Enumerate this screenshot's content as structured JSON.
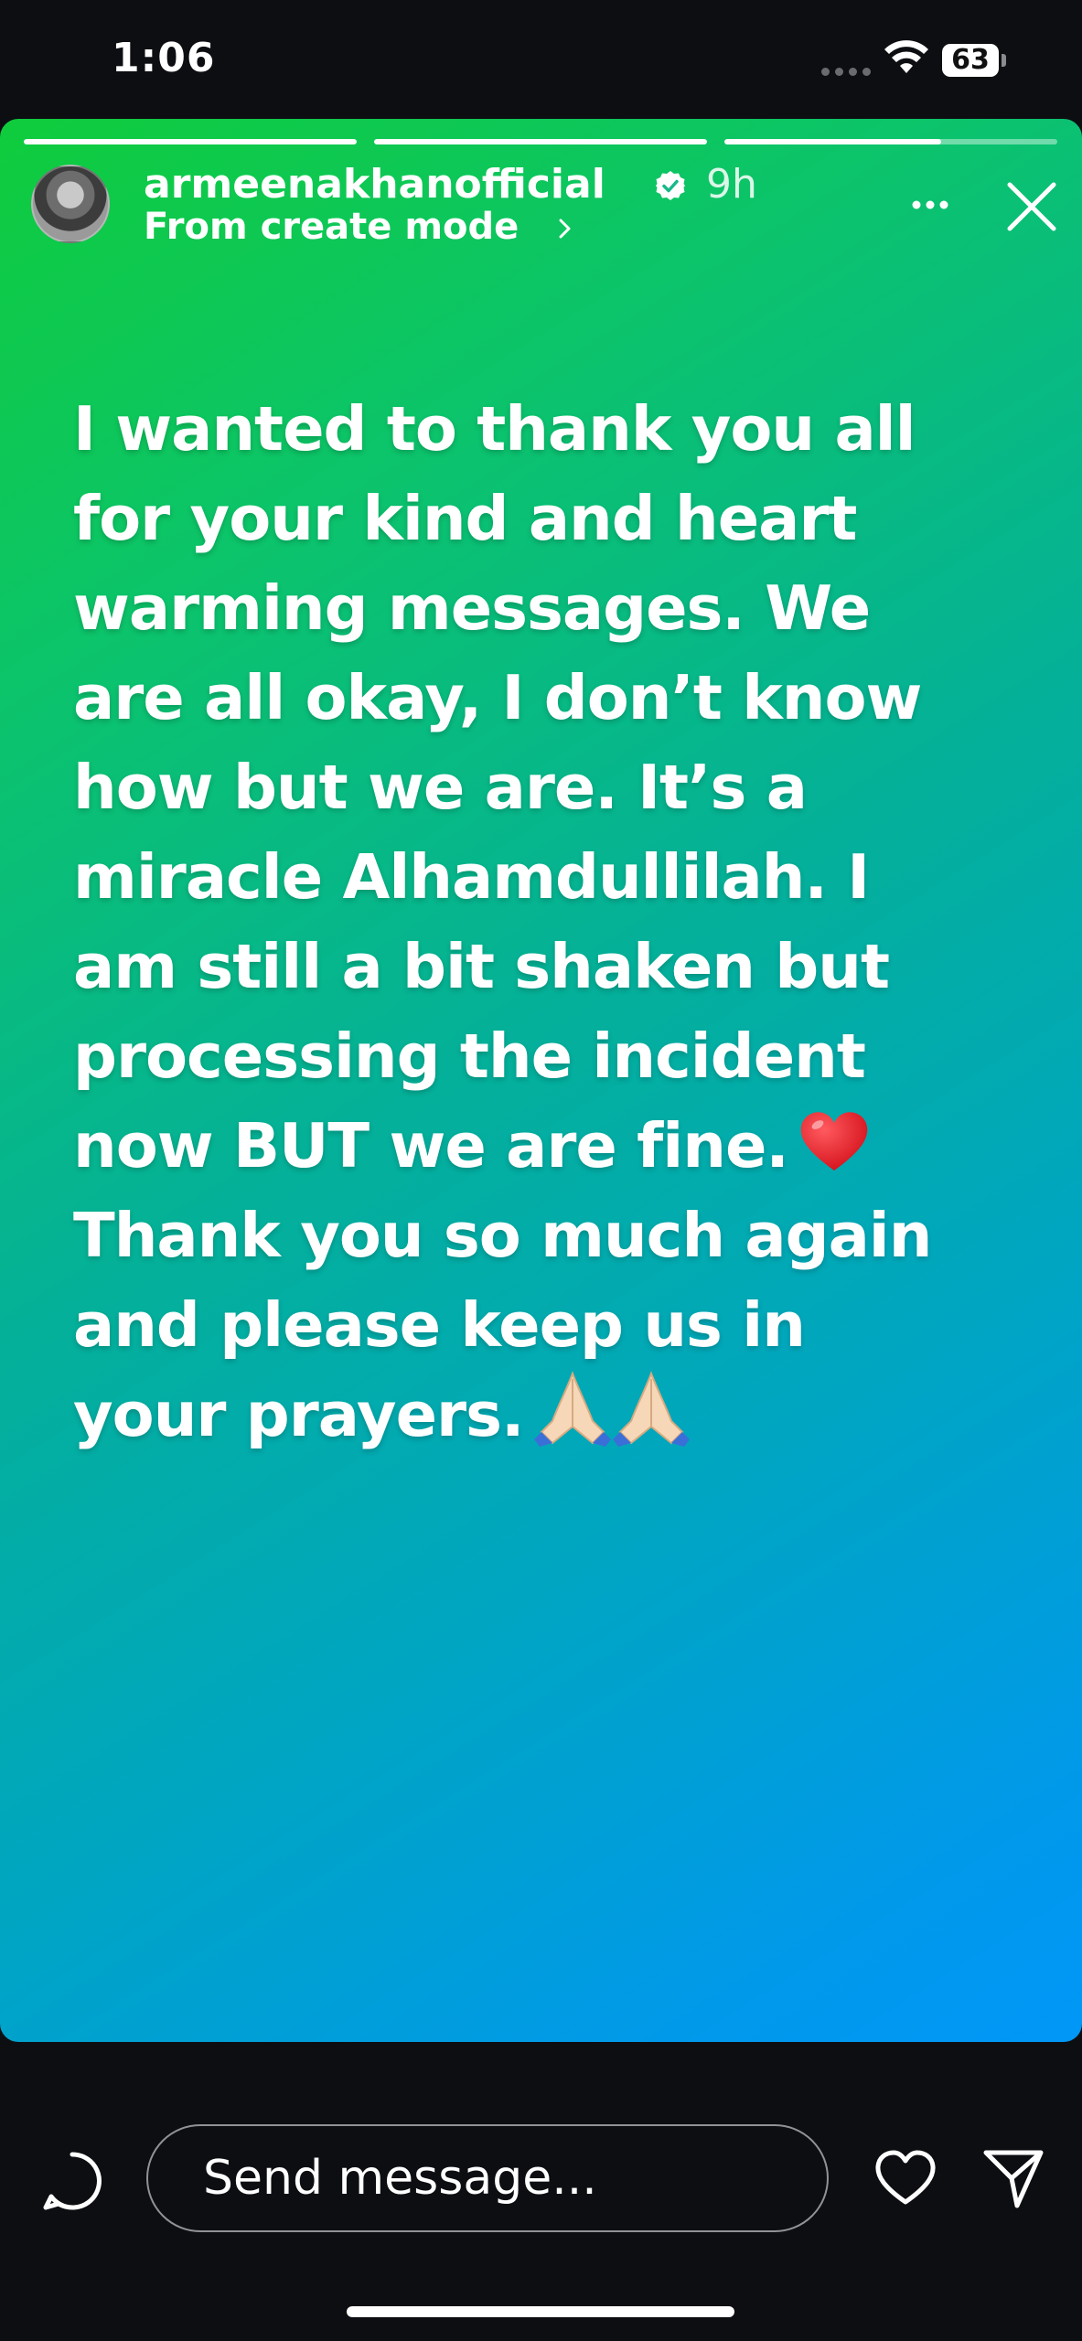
{
  "status_bar": {
    "time": "1:06",
    "battery": "63"
  },
  "story": {
    "progress": {
      "segments": 3,
      "current_segment": 3,
      "current_fill": 0.65
    },
    "username": "armeenakhanofficial",
    "verified": true,
    "time_ago": "9h",
    "subtitle": "From create mode",
    "text_lines": [
      "I wanted to thank you all",
      "for your kind and heart",
      "warming messages. We",
      "are all okay, I don’t know",
      "how but we are. It’s a",
      "miracle Alhamdullilah. I",
      "am still a bit shaken but",
      "processing the incident",
      "now BUT we are fine.",
      "Thank you so much again",
      "and please keep us in",
      "your prayers."
    ],
    "emojis": [
      "red-heart",
      "folded-hands",
      "folded-hands"
    ],
    "gradient_colors": [
      "#0fcc3c",
      "#04b09a",
      "#0097f7"
    ]
  },
  "footer": {
    "message_placeholder": "Send message..."
  }
}
